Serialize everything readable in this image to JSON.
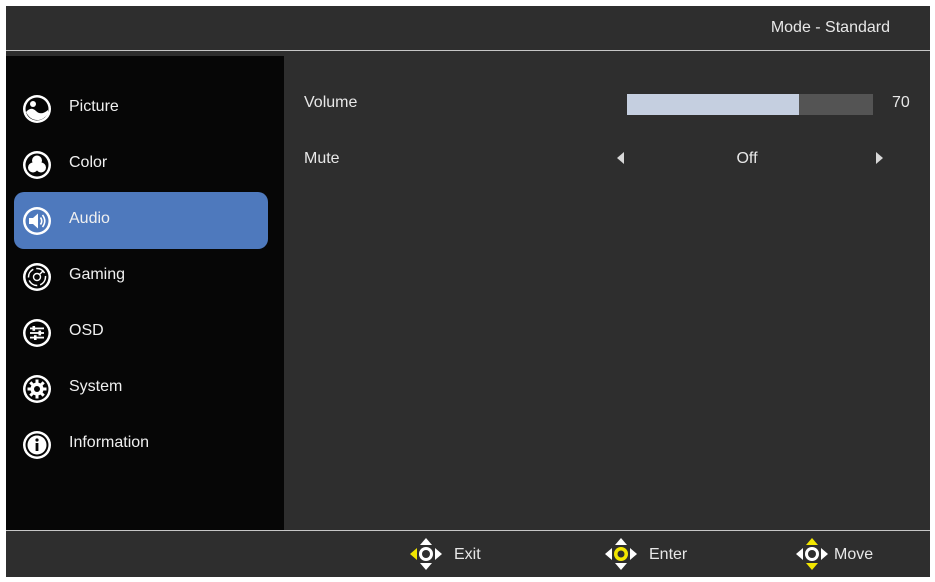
{
  "header": {
    "mode": "Mode - Standard"
  },
  "sidebar": {
    "items": [
      {
        "label": "Picture",
        "icon": "picture-icon",
        "active": false
      },
      {
        "label": "Color",
        "icon": "color-icon",
        "active": false
      },
      {
        "label": "Audio",
        "icon": "speaker-icon",
        "active": true
      },
      {
        "label": "Gaming",
        "icon": "gaming-icon",
        "active": false
      },
      {
        "label": "OSD",
        "icon": "sliders-icon",
        "active": false
      },
      {
        "label": "System",
        "icon": "gear-icon",
        "active": false
      },
      {
        "label": "Information",
        "icon": "info-icon",
        "active": false
      }
    ],
    "active_color": "#4e79bd"
  },
  "content": {
    "volume": {
      "label": "Volume",
      "value": "70",
      "fill_fraction": 0.7
    },
    "mute": {
      "label": "Mute",
      "value": "Off"
    }
  },
  "footer": {
    "hints": [
      {
        "label": "Exit",
        "icon": "joystick-left-icon"
      },
      {
        "label": "Enter",
        "icon": "joystick-press-icon"
      },
      {
        "label": "Move",
        "icon": "joystick-updown-icon"
      }
    ],
    "highlight_color": "#f2e600"
  }
}
